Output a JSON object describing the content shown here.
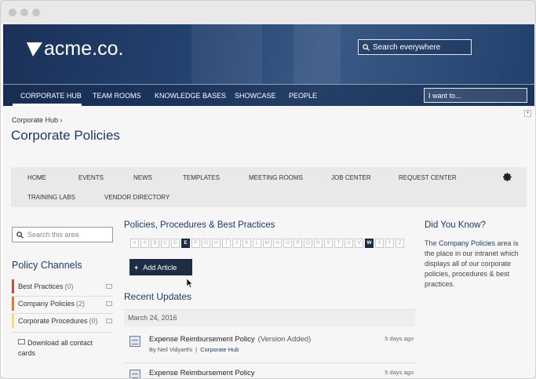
{
  "brand": {
    "logo_text": "acme.co."
  },
  "header": {
    "search_placeholder": "Search everywhere",
    "nav": [
      "CORPORATE HUB",
      "TEAM ROOMS",
      "KNOWLEDGE BASES",
      "SHOWCASE",
      "PEOPLE"
    ],
    "i_want": "I want to..."
  },
  "breadcrumb": "Corporate Hub ›",
  "page_title": "Corporate Policies",
  "subnav": {
    "row1": [
      "HOME",
      "EVENTS",
      "NEWS",
      "TEMPLATES",
      "MEETING ROOMS",
      "JOB CENTER",
      "REQUEST CENTER"
    ],
    "row2": [
      "TRAINING LABS",
      "VENDOR DIRECTORY"
    ]
  },
  "sidebar": {
    "search_placeholder": "Search this area",
    "channels_title": "Policy Channels",
    "channels": [
      {
        "label": "Best Practices",
        "count": "(0)",
        "color": "#c0504d"
      },
      {
        "label": "Company Policies",
        "count": "(2)",
        "color": "#e07b2a"
      },
      {
        "label": "Corporate Procedures",
        "count": "(0)",
        "color": "#f3dc7a"
      }
    ],
    "download": "Download all contact cards"
  },
  "main": {
    "title": "Policies, Procedures & Best Practices",
    "letters": [
      "#",
      "A",
      "B",
      "C",
      "D",
      "E",
      "F",
      "G",
      "H",
      "I",
      "J",
      "K",
      "L",
      "M",
      "N",
      "O",
      "P",
      "Q",
      "R",
      "S",
      "T",
      "U",
      "V",
      "W",
      "X",
      "Y",
      "Z"
    ],
    "active_letters": [
      "E",
      "W"
    ],
    "add_label": "Add Article",
    "recent_title": "Recent Updates",
    "date": "March 24, 2016",
    "updates": [
      {
        "title": "Expense Reimbursement Policy",
        "note": "(Version Added)",
        "author": "By Neil Vidyarthi",
        "divider": "|",
        "channel": "Corporate Hub",
        "ago": "5 days ago"
      },
      {
        "title": "Expense Reimbursement Policy",
        "note": "",
        "author": "",
        "divider": "",
        "channel": "",
        "ago": "5 days ago"
      }
    ]
  },
  "did_you_know": {
    "title": "Did You Know?",
    "prefix": "The ",
    "highlight": "Company Policies",
    "suffix": " area is the place in our intranet which displays all of our corporate policies, procedures & best practices."
  },
  "colors": {
    "navy": "#1d3a66",
    "button": "#1e2c44"
  }
}
